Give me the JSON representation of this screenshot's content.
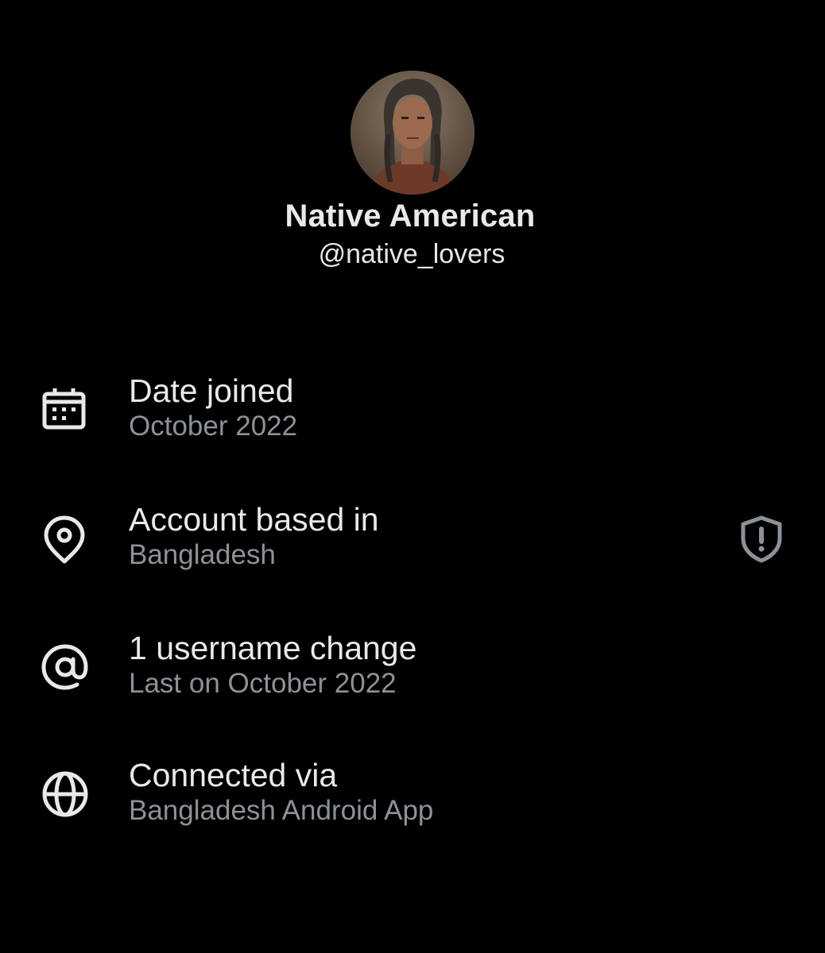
{
  "profile": {
    "display_name": "Native American",
    "handle": "@native_lovers",
    "avatar_icon": "profile-photo"
  },
  "rows": [
    {
      "icon": "calendar-icon",
      "title": "Date joined",
      "subtitle": "October 2022"
    },
    {
      "icon": "location-pin-icon",
      "title": "Account based in",
      "subtitle": "Bangladesh",
      "trailing_icon": "shield-exclamation-icon"
    },
    {
      "icon": "at-sign-icon",
      "title": "1 username change",
      "subtitle": "Last on October 2022"
    },
    {
      "icon": "globe-icon",
      "title": "Connected via",
      "subtitle": "Bangladesh Android App"
    }
  ],
  "colors": {
    "background": "#000000",
    "primary_text": "#e7e9ea",
    "secondary_text": "#8b9298",
    "icon": "#e7e9ea",
    "warning_icon": "#8b9298"
  }
}
